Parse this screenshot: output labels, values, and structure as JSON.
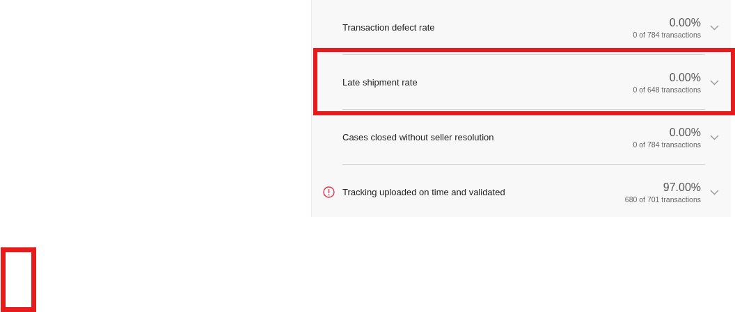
{
  "metrics": [
    {
      "label": "Transaction defect rate",
      "value": "0.00%",
      "detail": "0 of 784 transactions",
      "alert": false,
      "highlighted": false
    },
    {
      "label": "Late shipment rate",
      "value": "0.00%",
      "detail": "0 of 648 transactions",
      "alert": false,
      "highlighted": true
    },
    {
      "label": "Cases closed without seller resolution",
      "value": "0.00%",
      "detail": "0 of 784 transactions",
      "alert": false,
      "highlighted": false
    },
    {
      "label": "Tracking uploaded on time and validated",
      "value": "97.00%",
      "detail": "680 of 701 transactions",
      "alert": true,
      "highlighted": false
    }
  ],
  "markers": [
    {
      "kind": "box"
    }
  ]
}
